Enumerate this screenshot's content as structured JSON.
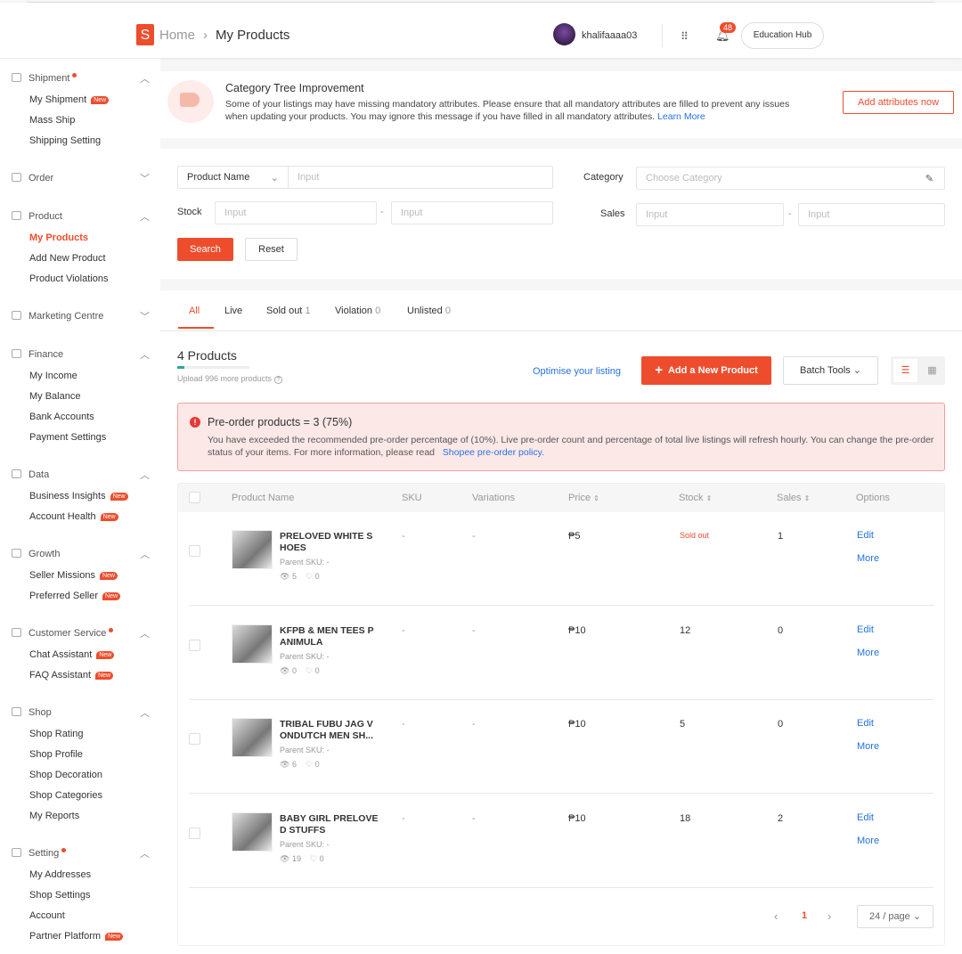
{
  "header": {
    "breadcrumb_home": "Home",
    "breadcrumb_current": "My Products",
    "username": "khalifaaaa03",
    "notification_count": "48",
    "education_hub": "Education Hub"
  },
  "sidebar": [
    {
      "label": "Shipment",
      "dot": true,
      "open": true,
      "items": [
        {
          "label": "My Shipment",
          "new": true
        },
        {
          "label": "Mass Ship"
        },
        {
          "label": "Shipping Setting"
        }
      ]
    },
    {
      "label": "Order",
      "open": false,
      "items": []
    },
    {
      "label": "Product",
      "open": true,
      "items": [
        {
          "label": "My Products",
          "active": true
        },
        {
          "label": "Add New Product"
        },
        {
          "label": "Product Violations"
        }
      ]
    },
    {
      "label": "Marketing Centre",
      "open": false,
      "items": []
    },
    {
      "label": "Finance",
      "open": true,
      "items": [
        {
          "label": "My Income"
        },
        {
          "label": "My Balance"
        },
        {
          "label": "Bank Accounts"
        },
        {
          "label": "Payment Settings"
        }
      ]
    },
    {
      "label": "Data",
      "open": true,
      "items": [
        {
          "label": "Business Insights",
          "new": true
        },
        {
          "label": "Account Health",
          "new": true
        }
      ]
    },
    {
      "label": "Growth",
      "open": true,
      "items": [
        {
          "label": "Seller Missions",
          "new": true
        },
        {
          "label": "Preferred Seller",
          "new": true
        }
      ]
    },
    {
      "label": "Customer Service",
      "dot": true,
      "open": true,
      "items": [
        {
          "label": "Chat Assistant",
          "new": true
        },
        {
          "label": "FAQ Assistant",
          "new": true
        }
      ]
    },
    {
      "label": "Shop",
      "open": true,
      "items": [
        {
          "label": "Shop Rating"
        },
        {
          "label": "Shop Profile"
        },
        {
          "label": "Shop Decoration"
        },
        {
          "label": "Shop Categories"
        },
        {
          "label": "My Reports"
        }
      ]
    },
    {
      "label": "Setting",
      "dot": true,
      "open": true,
      "items": [
        {
          "label": "My Addresses"
        },
        {
          "label": "Shop Settings"
        },
        {
          "label": "Account"
        },
        {
          "label": "Partner Platform",
          "new": true
        }
      ]
    }
  ],
  "new_badge": "New",
  "banner": {
    "title": "Category Tree Improvement",
    "text": "Some of your listings may have missing mandatory attributes. Please ensure that all mandatory attributes are filled to prevent any issues when updating your products. You may ignore this message if you have filled in all mandatory attributes.",
    "link": "Learn More",
    "button": "Add attributes now"
  },
  "filters": {
    "product_name_select": "Product Name",
    "input_placeholder": "Input",
    "stock_label": "Stock",
    "category_label": "Category",
    "category_placeholder": "Choose Category",
    "sales_label": "Sales",
    "search": "Search",
    "reset": "Reset",
    "dash": "-"
  },
  "tabs": [
    {
      "label": "All",
      "count": ""
    },
    {
      "label": "Live",
      "count": ""
    },
    {
      "label": "Sold out",
      "count": "1"
    },
    {
      "label": "Violation",
      "count": "0"
    },
    {
      "label": "Unlisted",
      "count": "0"
    }
  ],
  "summary": {
    "title": "4 Products",
    "upload_quota": "Upload 996 more products",
    "upload_progress": 0.004,
    "optimise": "Optimise your listing",
    "add_product": "Add a New Product",
    "batch_tools": "Batch Tools"
  },
  "alert": {
    "title": "Pre-order products = 3 (75%)",
    "text": "You have exceeded the recommended pre-order percentage of (10%). Live pre-order count and percentage of total live listings will refresh hourly. You can change the pre-order status of your items. For more information, please read",
    "link": "Shopee pre-order policy."
  },
  "table": {
    "headers": [
      "Product Name",
      "SKU",
      "Variations",
      "Price",
      "Stock",
      "Sales",
      "Options"
    ],
    "rows": [
      {
        "name": "PRELOVED WHITE S HOES",
        "parent_sku": "Parent SKU: -",
        "views": "5",
        "likes": "0",
        "sku": "-",
        "variations": "-",
        "price": "₱5",
        "stock": "Sold out",
        "sales": "1"
      },
      {
        "name": "KFPB & MEN TEES P ANIMULA",
        "parent_sku": "Parent SKU: -",
        "views": "0",
        "likes": "0",
        "sku": "-",
        "variations": "-",
        "price": "₱10",
        "stock": "12",
        "sales": "0"
      },
      {
        "name": "TRIBAL FUBU JAG V ONDUTCH MEN SH...",
        "parent_sku": "Parent SKU: -",
        "views": "6",
        "likes": "0",
        "sku": "-",
        "variations": "-",
        "price": "₱10",
        "stock": "5",
        "sales": "0"
      },
      {
        "name": "BABY GIRL PRELOVE D STUFFS",
        "parent_sku": "Parent SKU: -",
        "views": "19",
        "likes": "0",
        "sku": "-",
        "variations": "-",
        "price": "₱10",
        "stock": "18",
        "sales": "2"
      }
    ],
    "edit": "Edit",
    "more": "More"
  },
  "pagination": {
    "current": "1",
    "per_page": "24 / page"
  }
}
